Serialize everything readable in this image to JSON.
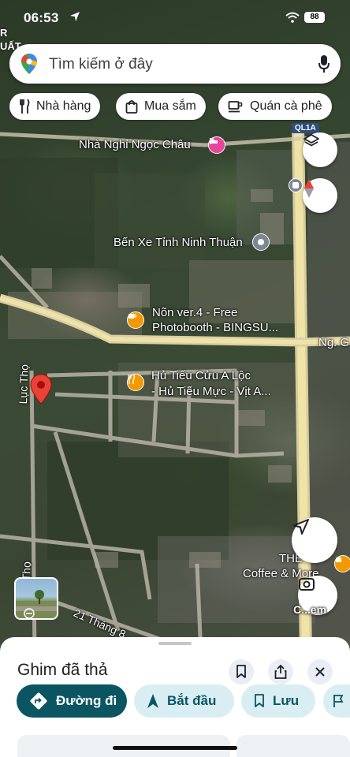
{
  "status_bar": {
    "time": "06:53",
    "battery": "88"
  },
  "edge_text": [
    "R",
    "UẤT"
  ],
  "search": {
    "placeholder": "Tìm kiếm ở đây"
  },
  "chips": [
    {
      "label": "Nhà hàng",
      "icon": "fork-knife-icon"
    },
    {
      "label": "Mua sắm",
      "icon": "shopping-bag-icon"
    },
    {
      "label": "Quán cà phê",
      "icon": "coffee-cup-icon"
    }
  ],
  "map": {
    "road_shield": "QL1A",
    "labels": {
      "nha_nghi": "Nhà Nghỉ Ngọc Châu",
      "ben_xe": "Bến Xe Tỉnh Ninh Thuận",
      "non_line1": "Nõn ver.4 - Free",
      "non_line2": "Photobooth - BINGSU...",
      "hu_tieu_line1": "Hủ Tiếu Cửu A Lộc",
      "hu_tieu_line2": "- Hủ Tiếu Mực - Vịt A...",
      "ng_g": "Ng. G",
      "luc_tho": "Lục Thọ",
      "tho_bottom": "Thọ",
      "the_line1": "THE",
      "the_line2": "Coffee & More",
      "street_21": "21 Tháng 8"
    },
    "camera_label": "C...em",
    "colors": {
      "pin": "#ea4335",
      "poi_orange": "#f29900",
      "hotel_pink": "#e8459b",
      "shield_blue": "#2e4e7e"
    }
  },
  "sheet": {
    "title": "Ghim đã thả",
    "actions": [
      {
        "label": "Đường đi",
        "icon": "directions-icon"
      },
      {
        "label": "Bắt đầu",
        "icon": "navigation-arrow-icon"
      },
      {
        "label": "Lưu",
        "icon": "bookmark-icon"
      }
    ],
    "colors": {
      "primary": "#0b57d0",
      "teal": "#0b5563",
      "tonal": "#d3e3fd"
    }
  }
}
